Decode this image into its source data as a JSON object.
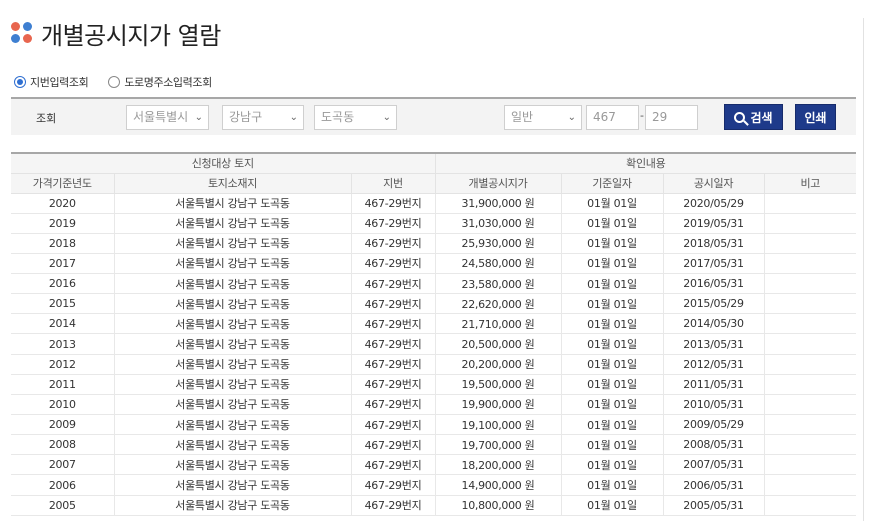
{
  "page": {
    "title": "개별공시지가 열람"
  },
  "radios": [
    {
      "label": "지번입력조회",
      "checked": true
    },
    {
      "label": "도로명주소입력조회",
      "checked": false
    }
  ],
  "search": {
    "label": "조회",
    "sido": "서울특별시",
    "sigungu": "강남구",
    "dong": "도곡동",
    "type": "일반",
    "bonbun": "467",
    "bubun": "29",
    "dash": "-",
    "search_btn": "검색",
    "print_btn": "인쇄"
  },
  "table": {
    "group_headers": [
      "신청대상 토지",
      "확인내용"
    ],
    "columns": [
      "가격기준년도",
      "토지소재지",
      "지번",
      "개별공시지가",
      "기준일자",
      "공시일자",
      "비고"
    ],
    "rows": [
      [
        "2020",
        "서울특별시 강남구 도곡동",
        "467-29번지",
        "31,900,000 원",
        "01월 01일",
        "2020/05/29",
        ""
      ],
      [
        "2019",
        "서울특별시 강남구 도곡동",
        "467-29번지",
        "31,030,000 원",
        "01월 01일",
        "2019/05/31",
        ""
      ],
      [
        "2018",
        "서울특별시 강남구 도곡동",
        "467-29번지",
        "25,930,000 원",
        "01월 01일",
        "2018/05/31",
        ""
      ],
      [
        "2017",
        "서울특별시 강남구 도곡동",
        "467-29번지",
        "24,580,000 원",
        "01월 01일",
        "2017/05/31",
        ""
      ],
      [
        "2016",
        "서울특별시 강남구 도곡동",
        "467-29번지",
        "23,580,000 원",
        "01월 01일",
        "2016/05/31",
        ""
      ],
      [
        "2015",
        "서울특별시 강남구 도곡동",
        "467-29번지",
        "22,620,000 원",
        "01월 01일",
        "2015/05/29",
        ""
      ],
      [
        "2014",
        "서울특별시 강남구 도곡동",
        "467-29번지",
        "21,710,000 원",
        "01월 01일",
        "2014/05/30",
        ""
      ],
      [
        "2013",
        "서울특별시 강남구 도곡동",
        "467-29번지",
        "20,500,000 원",
        "01월 01일",
        "2013/05/31",
        ""
      ],
      [
        "2012",
        "서울특별시 강남구 도곡동",
        "467-29번지",
        "20,200,000 원",
        "01월 01일",
        "2012/05/31",
        ""
      ],
      [
        "2011",
        "서울특별시 강남구 도곡동",
        "467-29번지",
        "19,500,000 원",
        "01월 01일",
        "2011/05/31",
        ""
      ],
      [
        "2010",
        "서울특별시 강남구 도곡동",
        "467-29번지",
        "19,900,000 원",
        "01월 01일",
        "2010/05/31",
        ""
      ],
      [
        "2009",
        "서울특별시 강남구 도곡동",
        "467-29번지",
        "19,100,000 원",
        "01월 01일",
        "2009/05/29",
        ""
      ],
      [
        "2008",
        "서울특별시 강남구 도곡동",
        "467-29번지",
        "19,700,000 원",
        "01월 01일",
        "2008/05/31",
        ""
      ],
      [
        "2007",
        "서울특별시 강남구 도곡동",
        "467-29번지",
        "18,200,000 원",
        "01월 01일",
        "2007/05/31",
        ""
      ],
      [
        "2006",
        "서울특별시 강남구 도곡동",
        "467-29번지",
        "14,900,000 원",
        "01월 01일",
        "2006/05/31",
        ""
      ],
      [
        "2005",
        "서울특별시 강남구 도곡동",
        "467-29번지",
        "10,800,000 원",
        "01월 01일",
        "2005/05/31",
        ""
      ]
    ]
  },
  "colors": {
    "button": "#1e3a8a",
    "dot_red": "#e8664f",
    "dot_blue": "#3e7fd1"
  }
}
